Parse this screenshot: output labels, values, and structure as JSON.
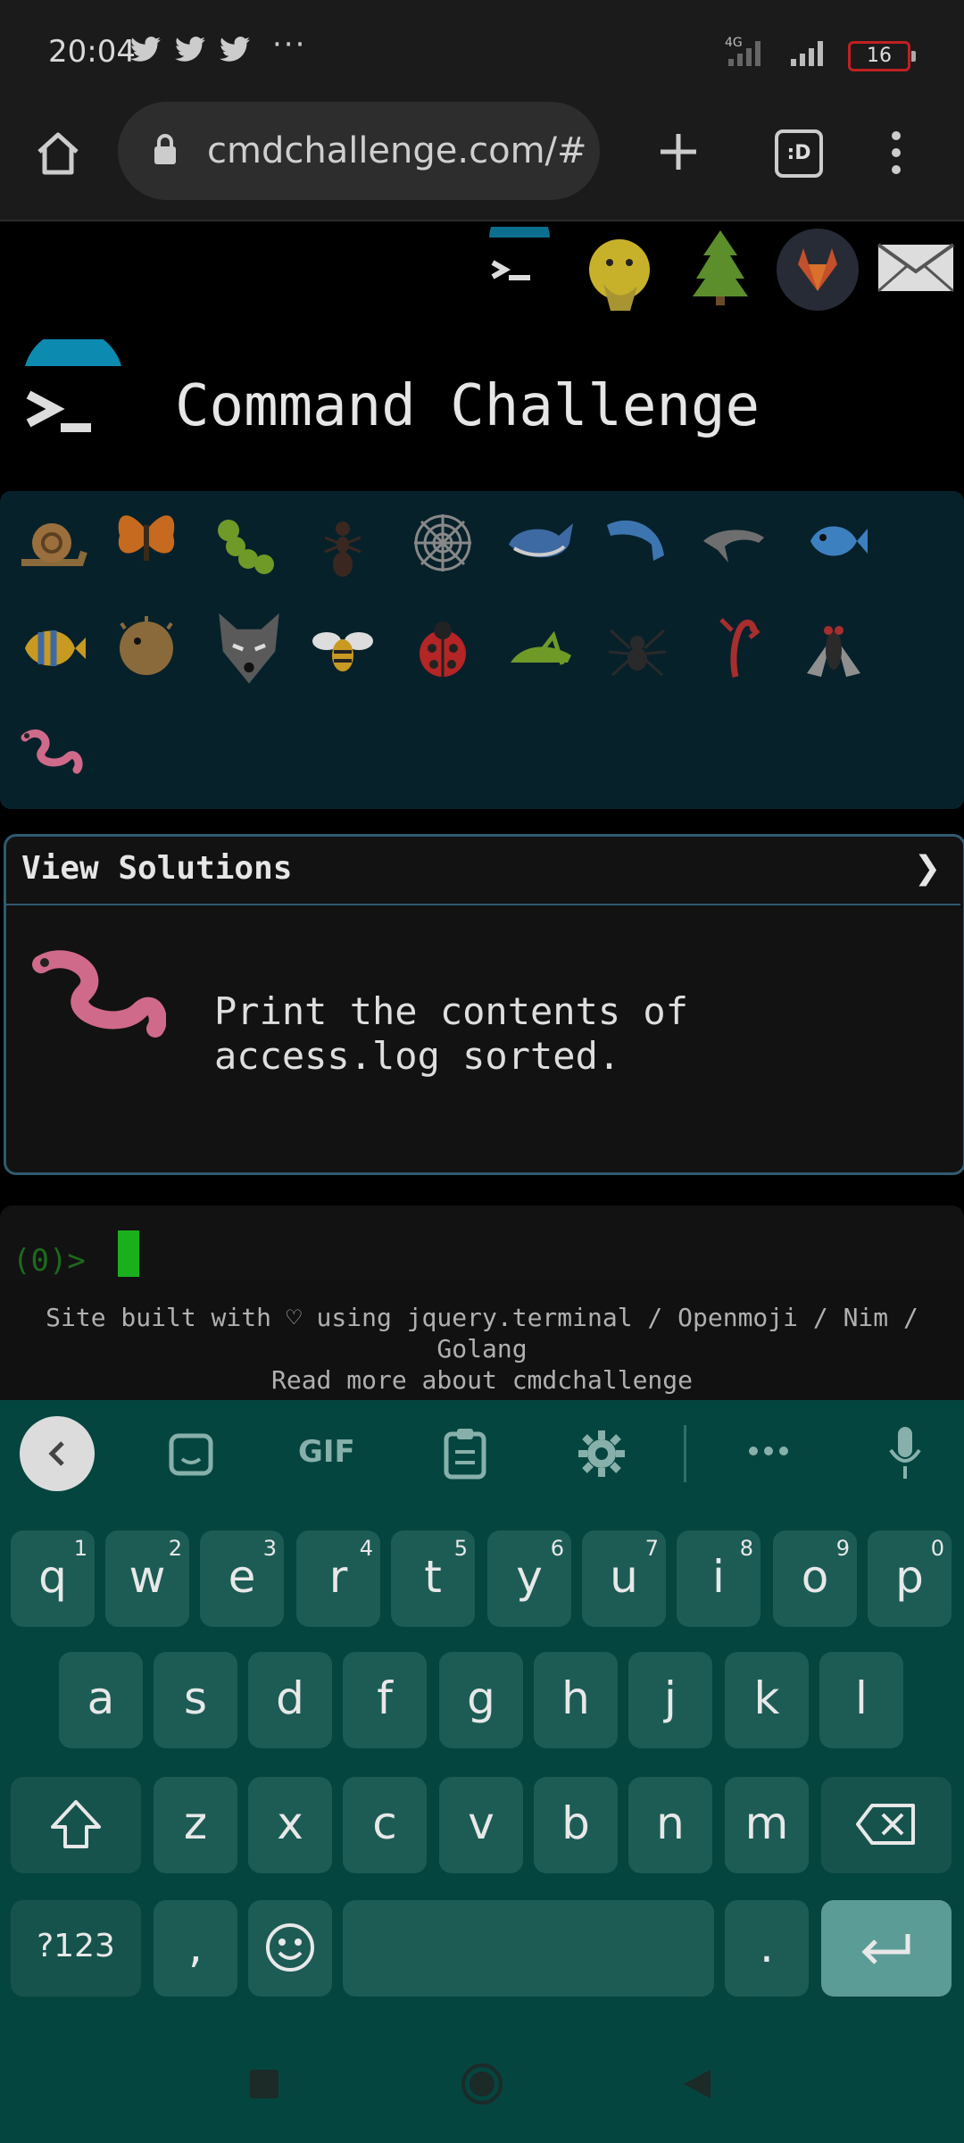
{
  "status_bar": {
    "time": "20:04",
    "dots": "···",
    "network": "4G",
    "battery": "16"
  },
  "browser": {
    "url": "cmdchallenge.com/#",
    "tabs_label": ":D"
  },
  "site": {
    "title": "Command Challenge",
    "view_solutions": "View Solutions",
    "chevron": "❯",
    "task": "Print the contents of access.log sorted.",
    "prompt": "(0)>",
    "footer_line1": "Site built with ♡ using jquery.terminal / Openmoji / Nim /",
    "footer_line2": "Golang",
    "footer_line3": "Read more about cmdchallenge"
  },
  "animals": [
    "snail",
    "butterfly",
    "caterpillar",
    "ant",
    "spider-web",
    "whale",
    "dolphin-blue",
    "dolphin-grey",
    "fish",
    "tropical-fish",
    "blowfish",
    "wolf",
    "bee",
    "ladybug",
    "cricket",
    "spider",
    "scorpion",
    "fly",
    "worm"
  ],
  "keyboard": {
    "toolbar": [
      "back-icon",
      "sticker-icon",
      "GIF",
      "clipboard-icon",
      "gear-icon",
      "more-icon",
      "mic-icon"
    ],
    "row1": [
      {
        "k": "q",
        "n": "1"
      },
      {
        "k": "w",
        "n": "2"
      },
      {
        "k": "e",
        "n": "3"
      },
      {
        "k": "r",
        "n": "4"
      },
      {
        "k": "t",
        "n": "5"
      },
      {
        "k": "y",
        "n": "6"
      },
      {
        "k": "u",
        "n": "7"
      },
      {
        "k": "i",
        "n": "8"
      },
      {
        "k": "o",
        "n": "9"
      },
      {
        "k": "p",
        "n": "0"
      }
    ],
    "row2": [
      "a",
      "s",
      "d",
      "f",
      "g",
      "h",
      "j",
      "k",
      "l"
    ],
    "row3": [
      "z",
      "x",
      "c",
      "v",
      "b",
      "n",
      "m"
    ],
    "symbols": "?123",
    "comma": ",",
    "period": "."
  }
}
